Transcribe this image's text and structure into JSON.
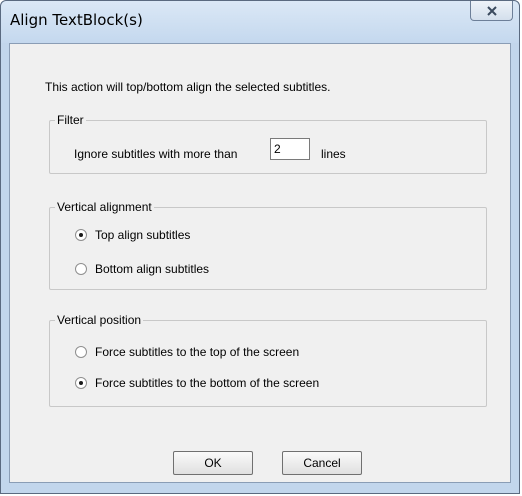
{
  "window": {
    "title": "Align TextBlock(s)"
  },
  "intro_text": "This action will top/bottom align the selected subtitles.",
  "filter": {
    "legend": "Filter",
    "label_before": "Ignore subtitles with more than",
    "value": "2",
    "label_after": "lines"
  },
  "vertical_alignment": {
    "legend": "Vertical alignment",
    "options": [
      {
        "label": "Top align subtitles",
        "checked": true
      },
      {
        "label": "Bottom align subtitles",
        "checked": false
      }
    ]
  },
  "vertical_position": {
    "legend": "Vertical position",
    "options": [
      {
        "label": "Force subtitles to the top of the screen",
        "checked": false
      },
      {
        "label": "Force subtitles to the bottom of the screen",
        "checked": true
      }
    ]
  },
  "buttons": {
    "ok": "OK",
    "cancel": "Cancel"
  },
  "icons": {
    "close": "close-icon"
  }
}
